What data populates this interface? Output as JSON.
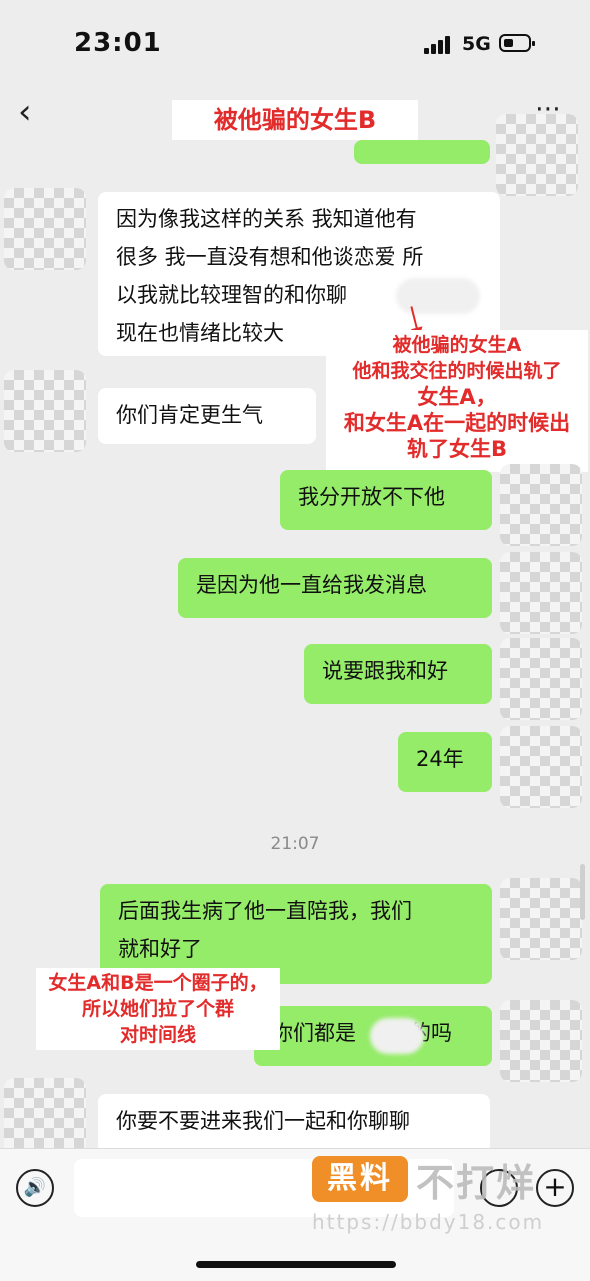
{
  "status_bar": {
    "time": "23:01",
    "network": "5G"
  },
  "header": {
    "back_icon": "chevron-left-icon",
    "title": "被他骗的女生B",
    "more_icon": "more-dots-icon"
  },
  "messages": {
    "m1_lines": [
      "因为像我这样的关系 我知道他有",
      "很多 我一直没有想和他谈恋爱 所",
      "以我就比较理智的和你聊",
      "现在也情绪比较大"
    ],
    "m2": "你们肯定更生气",
    "m3": "我分开放不下他",
    "m4": "是因为他一直给我发消息",
    "m5": "说要跟我和好",
    "m6": "24年",
    "timestamp": "21:07",
    "m7_lines": [
      "后面我生病了他一直陪我，我们",
      "就和好了"
    ],
    "m8_start": "你们都是",
    "m8_end": "的吗",
    "m9": "你要不要进来我们一起和你聊聊"
  },
  "annotations": {
    "note1_lines": [
      "被他骗的女生A",
      "他和我交往的时候出轨了",
      "女生A，",
      "和女生A在一起的时候出",
      "轨了女生B"
    ],
    "note2_lines": [
      "女生A和B是一个圈子的，",
      "所以她们拉了个群",
      "对时间线"
    ]
  },
  "watermark": {
    "brand": "黑料",
    "slogan": "不打烊",
    "url": "https://bbdy18.com"
  },
  "colors": {
    "sent_bubble": "#95ec69",
    "received_bubble": "#ffffff",
    "background": "#ededed",
    "annotation_red": "#e22b2b",
    "brand_orange": "#f08a1c"
  }
}
